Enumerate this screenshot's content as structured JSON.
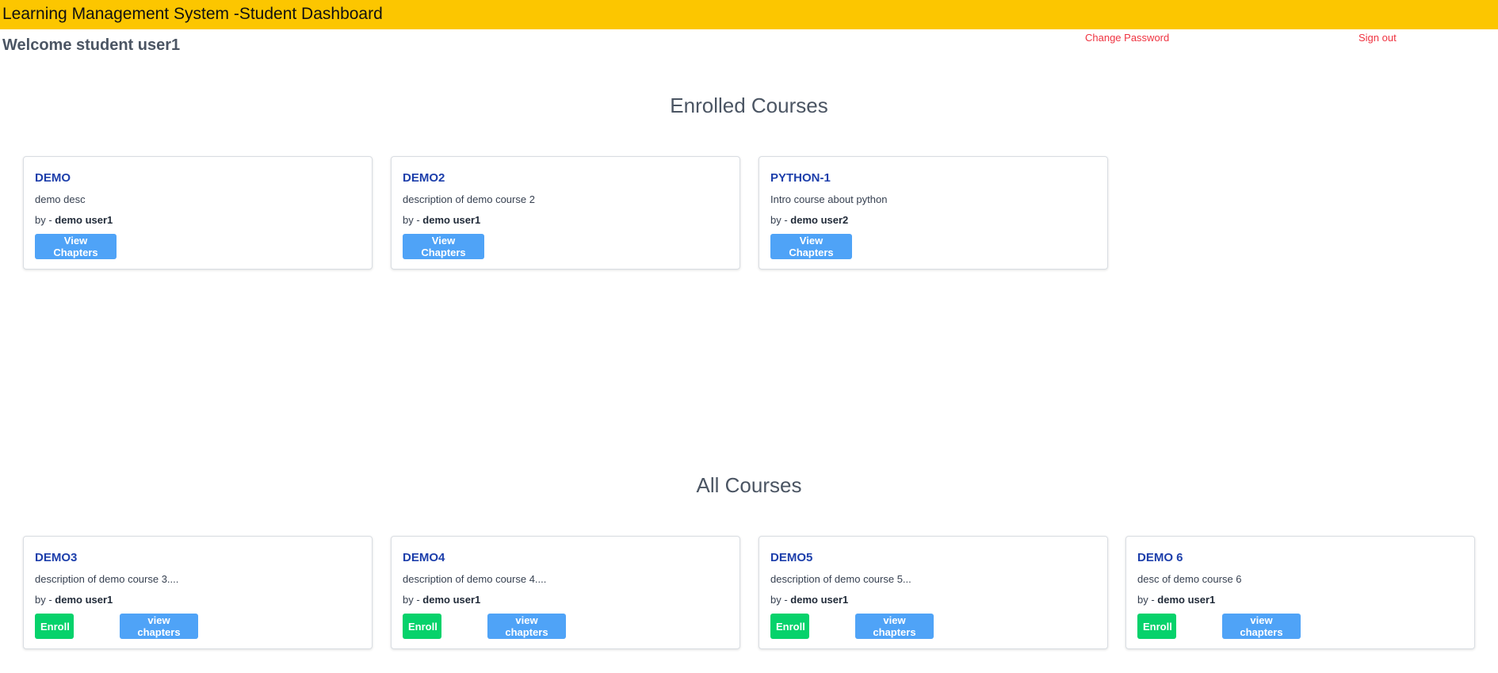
{
  "header": {
    "title": "Learning Management System -Student Dashboard",
    "welcome": "Welcome student user1",
    "change_password": "Change Password",
    "sign_out": "Sign out",
    "background_color": "#fcc600"
  },
  "enrolled": {
    "heading": "Enrolled Courses",
    "courses": [
      {
        "title": "DEMO",
        "description": "demo desc",
        "by_label": "by - ",
        "author": "demo user1",
        "button": "View Chapters"
      },
      {
        "title": "DEMO2",
        "description": "description of demo course 2",
        "by_label": "by - ",
        "author": "demo user1",
        "button": "View Chapters"
      },
      {
        "title": "PYTHON-1",
        "description": "Intro course about python",
        "by_label": "by - ",
        "author": "demo user2",
        "button": "View Chapters"
      }
    ]
  },
  "all": {
    "heading": "All Courses",
    "courses": [
      {
        "title": "DEMO3",
        "description": "description of demo course 3....",
        "by_label": "by - ",
        "author": "demo user1",
        "enroll": "Enroll",
        "view": "view chapters"
      },
      {
        "title": "DEMO4",
        "description": "description of demo course 4....",
        "by_label": "by - ",
        "author": "demo user1",
        "enroll": "Enroll",
        "view": "view chapters"
      },
      {
        "title": "DEMO5",
        "description": "description of demo course 5...",
        "by_label": "by - ",
        "author": "demo user1",
        "enroll": "Enroll",
        "view": "view chapters"
      },
      {
        "title": "DEMO 6",
        "description": "desc of demo course 6",
        "by_label": "by - ",
        "author": "demo user1",
        "enroll": "Enroll",
        "view": "view chapters"
      }
    ]
  },
  "colors": {
    "title_link": "#1d3fab",
    "button_blue": "#4fa3f7",
    "button_green": "#06d26b",
    "header_link": "#ef3340"
  }
}
